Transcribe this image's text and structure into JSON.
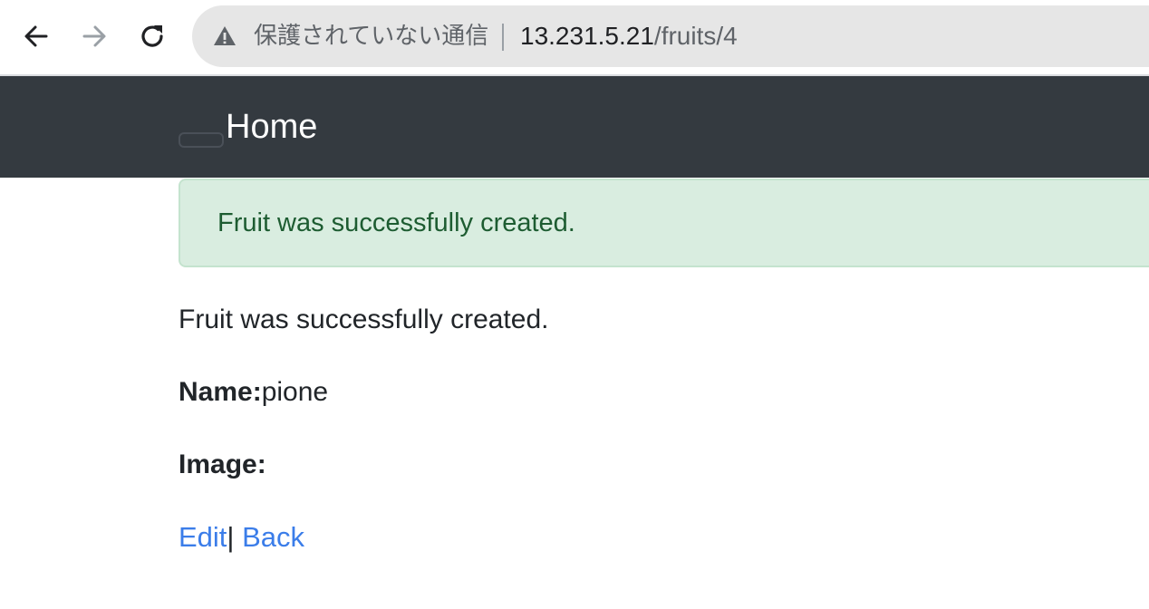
{
  "browser": {
    "security_label": "保護されていない通信",
    "url_host": "13.231.5.21",
    "url_path": "/fruits/4"
  },
  "navbar": {
    "brand": "Home"
  },
  "alert": {
    "message": "Fruit was successfully created."
  },
  "main": {
    "notice": "Fruit was successfully created.",
    "name_label": "Name:",
    "name_value": "pione",
    "image_label": "Image:",
    "edit_link": "Edit",
    "separator": "|",
    "back_link": "Back"
  },
  "colors": {
    "navbar_bg": "#343a40",
    "alert_bg": "#d9ede0",
    "alert_text": "#1d5c31",
    "link": "#3b7de9"
  }
}
